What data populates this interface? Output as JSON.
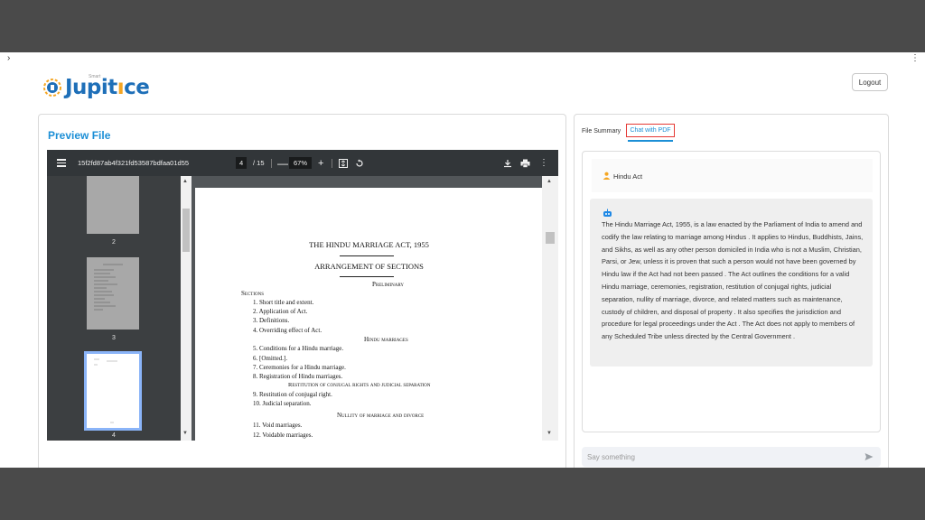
{
  "app": {
    "logo_text": "Jupit",
    "logo_text_2": "ce",
    "logo_sub": "Smart",
    "logout_label": "Logout"
  },
  "preview": {
    "title": "Preview File",
    "viewer": {
      "filename": "15f2fd87ab4f321fd53587bdfaa01d55",
      "current_page": "4",
      "total_pages": "/ 15",
      "zoom": "67%",
      "zoom_out_glyph": "—",
      "zoom_in_glyph": "+"
    },
    "thumbnails": [
      {
        "label": "2"
      },
      {
        "label": "3"
      },
      {
        "label": "4"
      }
    ],
    "document": {
      "title": "THE HINDU MARRIAGE ACT, 1955",
      "subtitle": "ARRANGEMENT OF SECTIONS",
      "lines": [
        {
          "text": "Preliminary",
          "kind": "heading"
        },
        {
          "text": "Sections",
          "kind": "label"
        },
        {
          "text": "1.   Short title and extent.",
          "kind": "item"
        },
        {
          "text": "2.   Application of Act.",
          "kind": "item"
        },
        {
          "text": "3.   Definitions.",
          "kind": "item"
        },
        {
          "text": "4.   Overriding effect of Act.",
          "kind": "item"
        },
        {
          "text": "Hindu marriages",
          "kind": "heading"
        },
        {
          "text": "5.   Conditions for a Hindu marriage.",
          "kind": "item"
        },
        {
          "text": "6.   [Omitted.].",
          "kind": "item"
        },
        {
          "text": "7.   Ceremonies for a Hindu marriage.",
          "kind": "item"
        },
        {
          "text": "8.   Registration of Hindu marriages.",
          "kind": "item"
        },
        {
          "text": "Restitution of conjugal rights and judicial separation",
          "kind": "heading"
        },
        {
          "text": "9.   Restitution of conjugal right.",
          "kind": "item"
        },
        {
          "text": "10. Judicial separation.",
          "kind": "item"
        },
        {
          "text": "Nullity of marriage and divorce",
          "kind": "heading"
        },
        {
          "text": "11. Void marriages.",
          "kind": "item"
        },
        {
          "text": "12. Voidable marriages.",
          "kind": "item"
        }
      ]
    }
  },
  "chat": {
    "tabs": [
      {
        "label": "File Summary"
      },
      {
        "label": "Chat with PDF"
      }
    ],
    "user_message": "Hindu Act",
    "bot_message": "The Hindu Marriage Act, 1955, is a law enacted by the Parliament of India to amend and codify the law relating to marriage among Hindus . It applies to Hindus, Buddhists, Jains, and Sikhs, as well as any other person domiciled in India who is not a Muslim, Christian, Parsi, or Jew, unless it is proven that such a person would not have been governed by Hindu law if the Act had not been passed . The Act outlines the conditions for a valid Hindu marriage, ceremonies, registration, restitution of conjugal rights, judicial separation, nullity of marriage, divorce, and related matters such as maintenance, custody of children, and disposal of property . It also specifies the jurisdiction and procedure for legal proceedings under the Act . The Act does not apply to members of any Scheduled Tribe unless directed by the Central Government .",
    "input_placeholder": "Say something"
  },
  "colors": {
    "accent": "#1c8fd6",
    "tab_outline": "#e53935",
    "user_icon": "#f5a623",
    "bot_icon": "#1e88e5"
  }
}
